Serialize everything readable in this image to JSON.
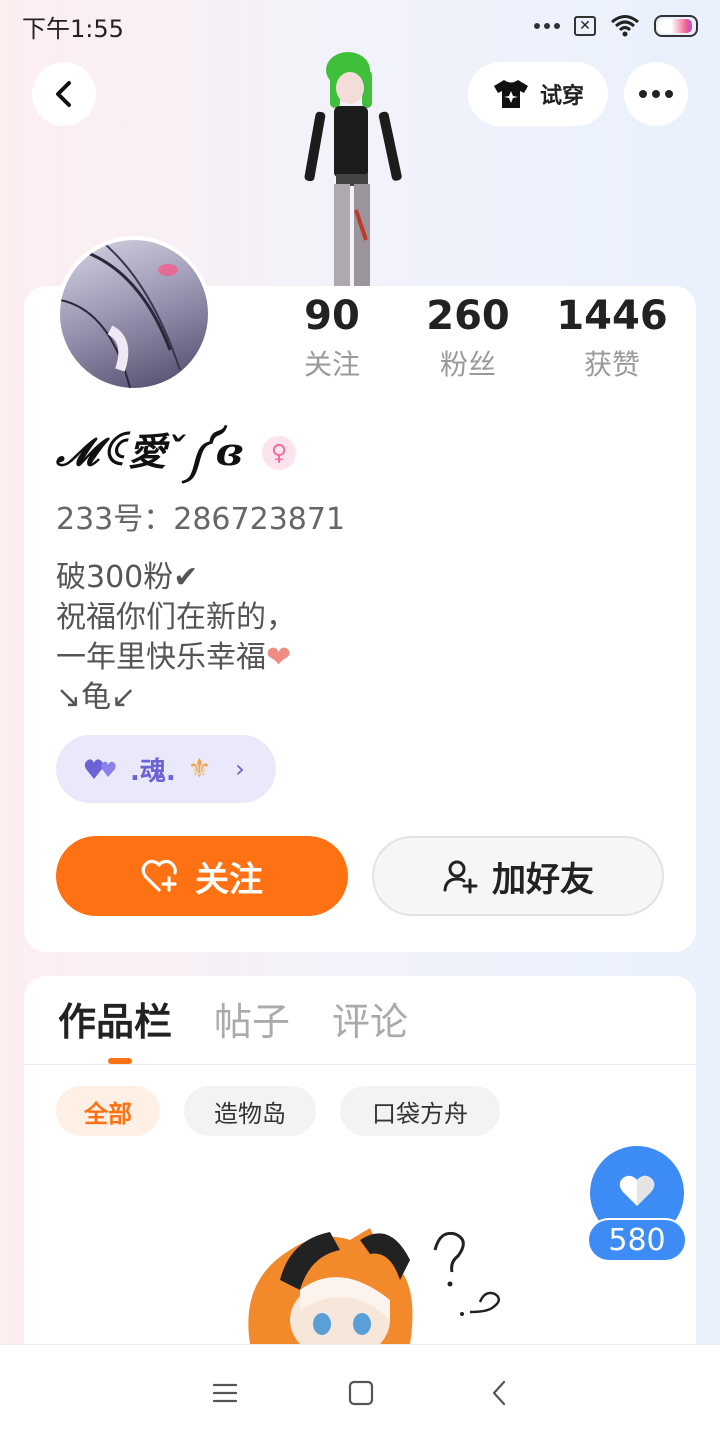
{
  "status_bar": {
    "time": "下午1:55",
    "icons": [
      "more-dots-icon",
      "sim-disabled-icon",
      "wifi-icon",
      "battery-icon"
    ]
  },
  "header": {
    "back_icon": "chevron-left-icon",
    "try_on_label": "试穿",
    "try_on_icon": "shirt-sparkle-icon",
    "more_icon": "more-horizontal-icon"
  },
  "profile": {
    "stats": [
      {
        "value": "90",
        "label": "关注"
      },
      {
        "value": "260",
        "label": "粉丝"
      },
      {
        "value": "1446",
        "label": "获赞"
      }
    ],
    "nickname": "𝓜ꀯ愛ˇ༼ɞ",
    "gender_symbol": "♀",
    "uid": "233号：286723871",
    "bio": "破300粉✔\n祝福你们在新的，\n一年里快乐幸福",
    "bio_heart": "❤",
    "bio_last": "↘龟↙",
    "club": {
      "name": ".魂.",
      "emblem": "⚜",
      "chevron": "›"
    },
    "actions": {
      "follow_label": "关注",
      "add_friend_label": "加好友"
    }
  },
  "works": {
    "tabs": [
      {
        "label": "作品栏",
        "active": true
      },
      {
        "label": "帖子",
        "active": false
      },
      {
        "label": "评论",
        "active": false
      }
    ],
    "filters": [
      {
        "label": "全部",
        "active": true
      },
      {
        "label": "造物岛",
        "active": false
      },
      {
        "label": "口袋方舟",
        "active": false
      }
    ],
    "like_count": "580"
  },
  "nav": {
    "icons": [
      "menu-icon",
      "home-square-icon",
      "back-triangle-icon"
    ]
  },
  "colors": {
    "accent": "#ff7214",
    "like_blue": "#3d8bf5",
    "club_purple": "#6b62d6",
    "gender_pink": "#f06a9b"
  }
}
